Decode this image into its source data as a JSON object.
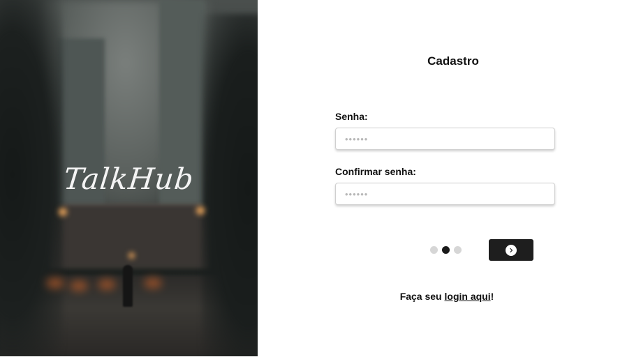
{
  "hero": {
    "logo_text": "TalkHub"
  },
  "form": {
    "title": "Cadastro",
    "password": {
      "label": "Senha:",
      "placeholder": "••••••"
    },
    "confirm_password": {
      "label": "Confirmar senha:",
      "placeholder": "••••••"
    },
    "steps": {
      "total": 3,
      "current": 2
    },
    "next_button_icon": "chevron-right-icon"
  },
  "footer": {
    "login_prefix": "Faça seu ",
    "login_link": "login aqui",
    "login_suffix": "!"
  },
  "colors": {
    "button": "#1e1e1e",
    "dot_active": "#1a1a1a",
    "dot_inactive": "#d6d6d6"
  }
}
